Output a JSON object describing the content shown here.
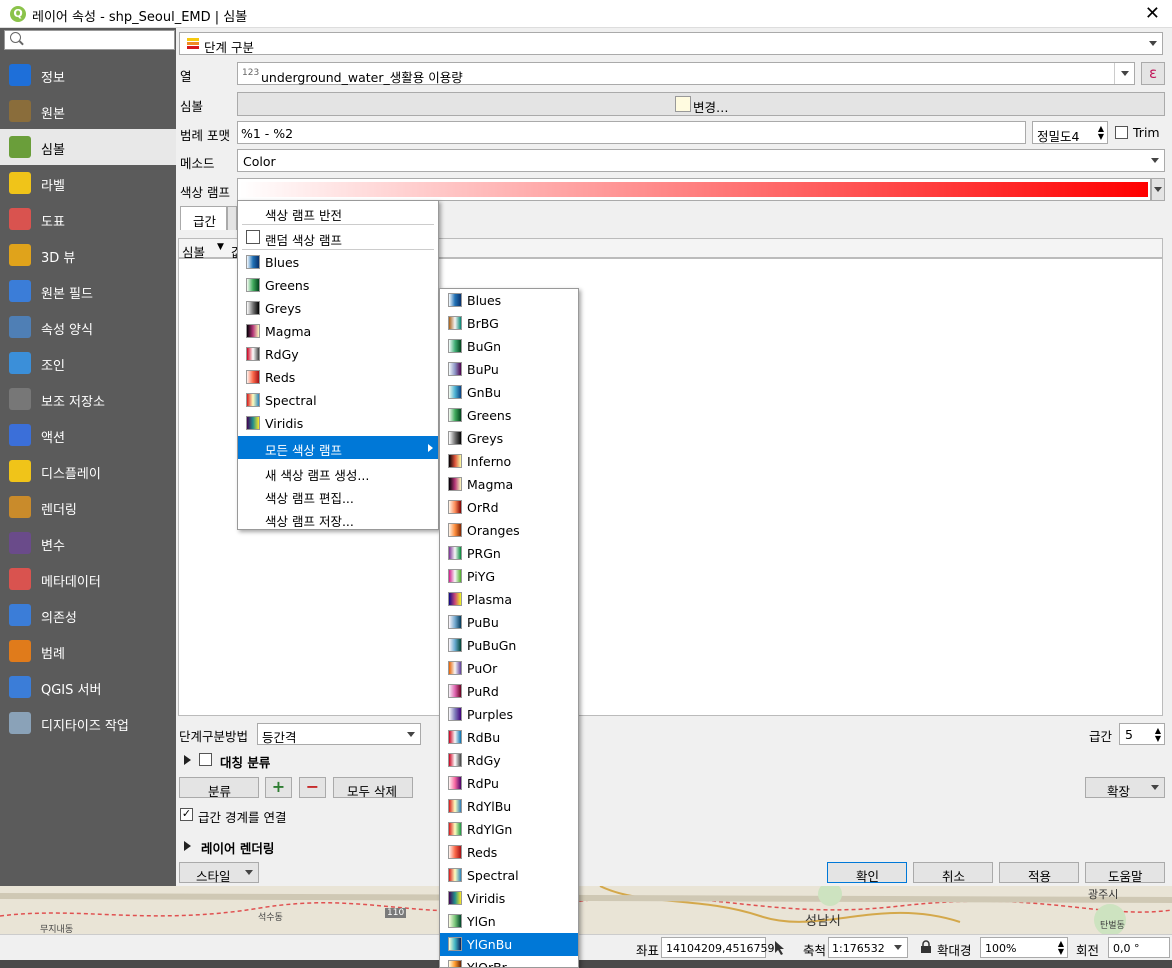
{
  "window": {
    "title": "레이어 속성 - shp_Seoul_EMD | 심볼",
    "close": "✕",
    "logo": "Q"
  },
  "sidebar": {
    "items": [
      {
        "label": "정보"
      },
      {
        "label": "원본"
      },
      {
        "label": "심볼"
      },
      {
        "label": "라벨"
      },
      {
        "label": "도표"
      },
      {
        "label": "3D 뷰"
      },
      {
        "label": "원본 필드"
      },
      {
        "label": "속성 양식"
      },
      {
        "label": "조인"
      },
      {
        "label": "보조 저장소"
      },
      {
        "label": "액션"
      },
      {
        "label": "디스플레이"
      },
      {
        "label": "렌더링"
      },
      {
        "label": "변수"
      },
      {
        "label": "메타데이터"
      },
      {
        "label": "의존성"
      },
      {
        "label": "범례"
      },
      {
        "label": "QGIS 서버"
      },
      {
        "label": "디지타이즈 작업"
      }
    ]
  },
  "renderer": {
    "value": "단계 구분"
  },
  "form": {
    "column_label": "열",
    "column_type": "123",
    "column_value": "underground_water_생활용 이용량",
    "expr_icon": "ε",
    "symbol_label": "심볼",
    "symbol_button": "변경…",
    "legend_label": "범례 포맷",
    "legend_value": "%1 - %2",
    "precision_value": "정밀도4",
    "trim_label": "Trim",
    "method_label": "메소드",
    "method_value": "Color",
    "ramp_label": "색상 램프"
  },
  "tabs": {
    "classes": "급간"
  },
  "table": {
    "symbol_header": "심볼",
    "value_header_partial": "값"
  },
  "bottom": {
    "mode_label": "단계구분방법",
    "mode_value": "등간격",
    "classes_label": "급간",
    "classes_value": "5",
    "symmetric_label": "대칭 분류",
    "classify_button": "분류",
    "add_icon": "+",
    "remove_icon": "−",
    "delete_all_button": "모두 삭제",
    "advanced_button": "확장",
    "link_label": "급간 경계를 연결",
    "link_check": "✓",
    "layer_rendering_label": "레이어 렌더링",
    "style_button": "스타일",
    "ok_button": "확인",
    "cancel_button": "취소",
    "apply_button": "적용",
    "help_button": "도움말"
  },
  "menu1": {
    "invert": "색상 램프 반전",
    "random": "랜덤 색상 램프",
    "ramps": [
      {
        "label": "Blues",
        "colors": [
          "#f7fbff",
          "#2171b5",
          "#08306b"
        ]
      },
      {
        "label": "Greens",
        "colors": [
          "#f7fcf5",
          "#41ab5d",
          "#00441b"
        ]
      },
      {
        "label": "Greys",
        "colors": [
          "#ffffff",
          "#737373",
          "#000000"
        ]
      },
      {
        "label": "Magma",
        "colors": [
          "#000004",
          "#b73779",
          "#fcfdbf"
        ]
      },
      {
        "label": "RdGy",
        "colors": [
          "#ca0020",
          "#ffffff",
          "#404040"
        ]
      },
      {
        "label": "Reds",
        "colors": [
          "#fff5f0",
          "#fb6a4a",
          "#a50f15"
        ]
      },
      {
        "label": "Spectral",
        "colors": [
          "#d7191c",
          "#ffffbf",
          "#2b83ba"
        ]
      },
      {
        "label": "Viridis",
        "colors": [
          "#440154",
          "#21918c",
          "#fde725"
        ]
      }
    ],
    "all_ramps": "모든 색상 램프",
    "new_ramp": "새 색상 램프 생성...",
    "edit_ramp": "색상 램프 편집...",
    "save_ramp": "색상 램프 저장..."
  },
  "menu2": {
    "ramps": [
      {
        "label": "Blues",
        "colors": [
          "#f7fbff",
          "#2171b5",
          "#08306b"
        ]
      },
      {
        "label": "BrBG",
        "colors": [
          "#a6611a",
          "#f5f5f5",
          "#018571"
        ]
      },
      {
        "label": "BuGn",
        "colors": [
          "#f7fcfd",
          "#41ae76",
          "#00441b"
        ]
      },
      {
        "label": "BuPu",
        "colors": [
          "#f7fcfd",
          "#8c96c6",
          "#4d004b"
        ]
      },
      {
        "label": "GnBu",
        "colors": [
          "#f7fcf0",
          "#4eb3d3",
          "#084081"
        ]
      },
      {
        "label": "Greens",
        "colors": [
          "#f7fcf5",
          "#41ab5d",
          "#00441b"
        ]
      },
      {
        "label": "Greys",
        "colors": [
          "#ffffff",
          "#737373",
          "#000000"
        ]
      },
      {
        "label": "Inferno",
        "colors": [
          "#000004",
          "#dd513a",
          "#fcffa4"
        ]
      },
      {
        "label": "Magma",
        "colors": [
          "#000004",
          "#b73779",
          "#fcfdbf"
        ]
      },
      {
        "label": "OrRd",
        "colors": [
          "#fff7ec",
          "#fc8d59",
          "#7f0000"
        ]
      },
      {
        "label": "Oranges",
        "colors": [
          "#fff5eb",
          "#fd8d3c",
          "#7f2704"
        ]
      },
      {
        "label": "PRGn",
        "colors": [
          "#7b3294",
          "#f7f7f7",
          "#008837"
        ]
      },
      {
        "label": "PiYG",
        "colors": [
          "#d01c8b",
          "#f7f7f7",
          "#4dac26"
        ]
      },
      {
        "label": "Plasma",
        "colors": [
          "#0d0887",
          "#cc4778",
          "#f0f921"
        ]
      },
      {
        "label": "PuBu",
        "colors": [
          "#fff7fb",
          "#74a9cf",
          "#023858"
        ]
      },
      {
        "label": "PuBuGn",
        "colors": [
          "#fff7fb",
          "#67a9cf",
          "#014636"
        ]
      },
      {
        "label": "PuOr",
        "colors": [
          "#e66101",
          "#f7f7f7",
          "#5e3c99"
        ]
      },
      {
        "label": "PuRd",
        "colors": [
          "#f7f4f9",
          "#df65b0",
          "#67001f"
        ]
      },
      {
        "label": "Purples",
        "colors": [
          "#fcfbfd",
          "#807dba",
          "#3f007d"
        ]
      },
      {
        "label": "RdBu",
        "colors": [
          "#ca0020",
          "#f7f7f7",
          "#0571b0"
        ]
      },
      {
        "label": "RdGy",
        "colors": [
          "#ca0020",
          "#ffffff",
          "#404040"
        ]
      },
      {
        "label": "RdPu",
        "colors": [
          "#fff7f3",
          "#f768a1",
          "#49006a"
        ]
      },
      {
        "label": "RdYlBu",
        "colors": [
          "#d7191c",
          "#ffffbf",
          "#2c7bb6"
        ]
      },
      {
        "label": "RdYlGn",
        "colors": [
          "#d7191c",
          "#ffffbf",
          "#1a9641"
        ]
      },
      {
        "label": "Reds",
        "colors": [
          "#fff5f0",
          "#fb6a4a",
          "#a50f15"
        ]
      },
      {
        "label": "Spectral",
        "colors": [
          "#d7191c",
          "#ffffbf",
          "#2b83ba"
        ]
      },
      {
        "label": "Viridis",
        "colors": [
          "#440154",
          "#21918c",
          "#fde725"
        ]
      },
      {
        "label": "YlGn",
        "colors": [
          "#ffffe5",
          "#78c679",
          "#004529"
        ]
      },
      {
        "label": "YlGnBu",
        "colors": [
          "#ffffd9",
          "#41b6c4",
          "#081d58"
        ]
      },
      {
        "label": "YlOrBr",
        "colors": [
          "#ffffe5",
          "#fe9929",
          "#662506"
        ]
      }
    ],
    "selected": "YlGnBu"
  },
  "map": {
    "labels": [
      "무지내동",
      "석수동",
      "110",
      "성남시",
      "광주시",
      "탄벌동"
    ]
  },
  "status": {
    "coord_label": "좌표",
    "coord_value": "14104209,4516759",
    "scale_label": "축척",
    "scale_value": "1:176532",
    "magnifier_label": "확대경",
    "magnifier_value": "100%",
    "rotation_label": "회전",
    "rotation_value": "0,0 °"
  },
  "colors": {
    "accent": "#0078d7",
    "ramp_start": "#ffffff",
    "ramp_end": "#ff0000",
    "sidebar": "#5b5b5b"
  }
}
